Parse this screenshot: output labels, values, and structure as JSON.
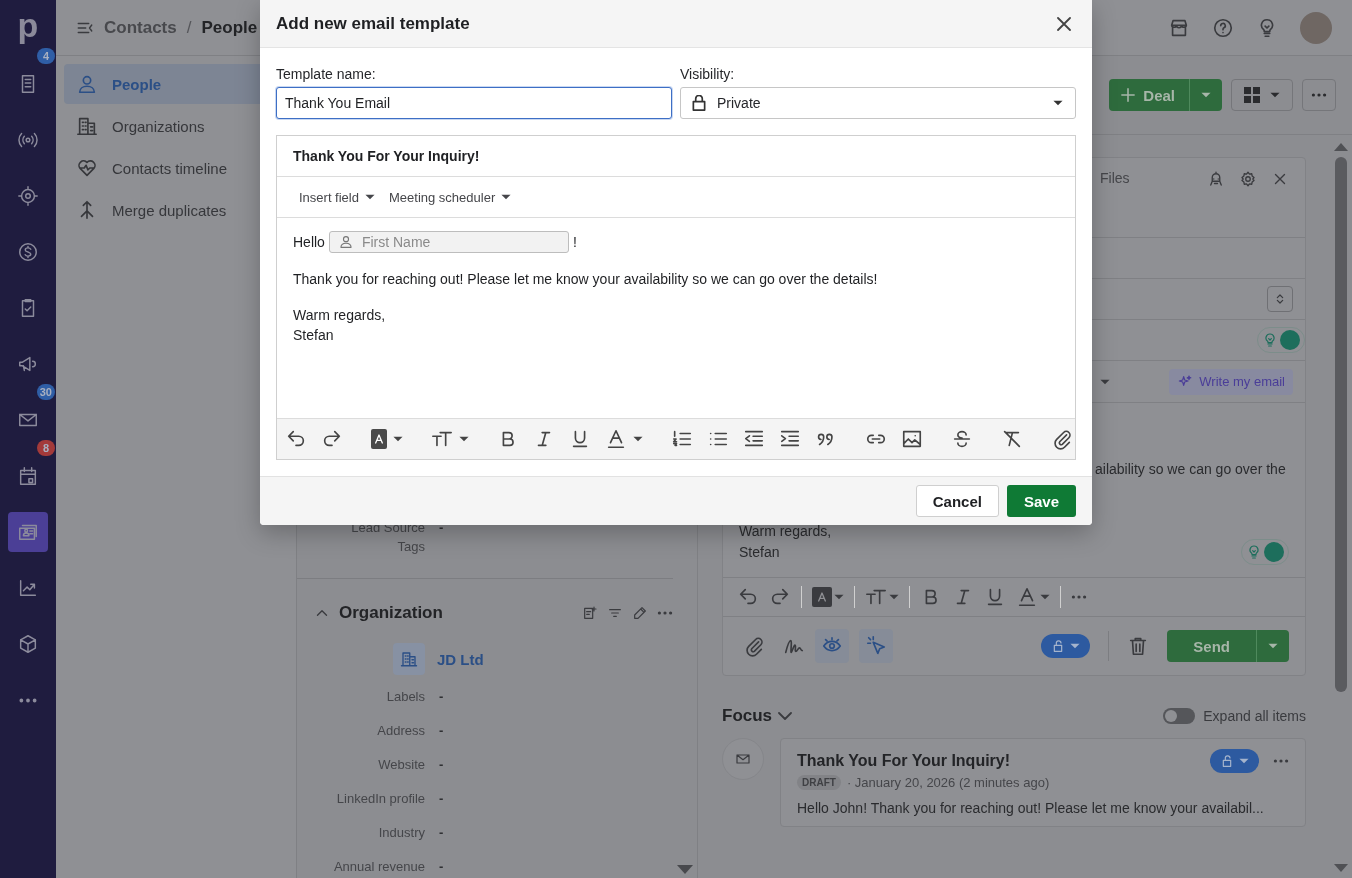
{
  "nav": {
    "logo": "p",
    "items": [
      {
        "selected": false,
        "badge": "4",
        "color": "#2f5ea6"
      },
      {
        "selected": false
      },
      {
        "selected": false
      },
      {
        "selected": false
      },
      {
        "selected": false
      },
      {
        "selected": false
      },
      {
        "selected": false,
        "badge": "30",
        "color": "#2f5ea6"
      },
      {
        "selected": false,
        "badge": "8",
        "color": "#a33a3a"
      },
      {
        "selected": true
      },
      {
        "selected": false
      },
      {
        "selected": false
      },
      {
        "selected": false
      }
    ]
  },
  "topbar": {
    "breadcrumb": [
      "Contacts",
      "People"
    ],
    "separator": "/"
  },
  "sidebar": {
    "items": [
      {
        "label": "People",
        "selected": true
      },
      {
        "label": "Organizations",
        "selected": false
      },
      {
        "label": "Contacts timeline",
        "selected": false
      },
      {
        "label": "Merge duplicates",
        "selected": false
      }
    ]
  },
  "toolbar": {
    "deal_button": "Deal"
  },
  "details": {
    "fields": [
      {
        "label": "Lead Source",
        "value": "-"
      },
      {
        "label": "Tags"
      }
    ]
  },
  "organization": {
    "title": "Organization",
    "name": "JD Ltd",
    "fields": [
      {
        "label": "Labels",
        "value": "-"
      },
      {
        "label": "Address",
        "value": "-"
      },
      {
        "label": "Website",
        "value": "-"
      },
      {
        "label": "LinkedIn profile",
        "value": "-"
      },
      {
        "label": "Industry",
        "value": "-"
      },
      {
        "label": "Annual revenue",
        "value": "-"
      }
    ]
  },
  "composer": {
    "tab": "Files",
    "body_fragment": "ailability so we can go over the",
    "signature": [
      "Warm regards,",
      "Stefan"
    ],
    "ai_button": "Write my email",
    "send_button": "Send"
  },
  "focus": {
    "title": "Focus",
    "expand_toggle": {
      "label": "Expand all items",
      "on": false
    }
  },
  "activity": [
    {
      "title": "Thank You For Your Inquiry!",
      "status": "DRAFT",
      "date": "· January 20, 2026 (2 minutes ago)",
      "preview": "Hello John! Thank you for reaching out! Please let me know your availabil..."
    }
  ],
  "modal": {
    "title": "Add new email template",
    "template_name": {
      "label": "Template name:",
      "value": "Thank You Email"
    },
    "visibility": {
      "label": "Visibility:",
      "value": "Private"
    },
    "subject": "Thank You For Your Inquiry!",
    "insert_menus": [
      "Insert field",
      "Meeting scheduler"
    ],
    "greeting": "Hello",
    "merge_field": {
      "placeholder": "First Name"
    },
    "greeting_end": "!",
    "paragraphs": [
      "Thank you for reaching out! Please let me know your availability so we can go over the details!"
    ],
    "signature": [
      "Warm regards,",
      "Stefan"
    ],
    "buttons": {
      "cancel": "Cancel",
      "save": "Save"
    }
  }
}
